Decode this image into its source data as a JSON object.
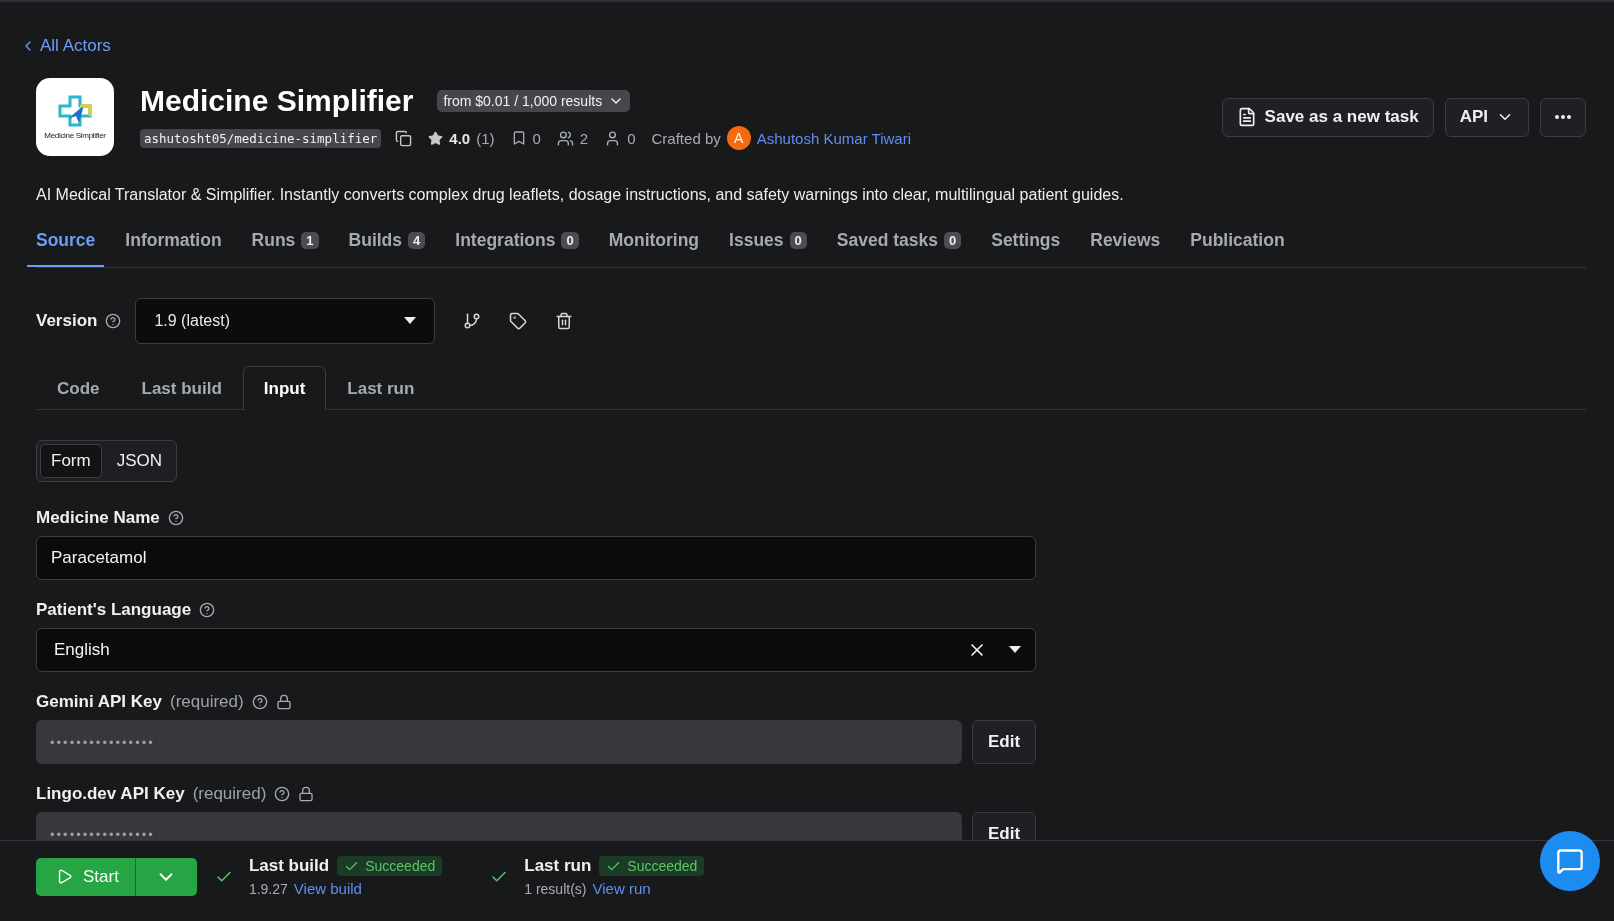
{
  "back_link": "All Actors",
  "actor": {
    "title": "Medicine Simplifier",
    "logo_caption": "Medicine Simplifier",
    "pricing": "from $0.01 / 1,000 results",
    "slug": "ashutosht05/medicine-simplifier",
    "rating": "4.0",
    "rating_count": "(1)",
    "bookmarks": "0",
    "users": "2",
    "monthly_users": "0",
    "crafted_by_label": "Crafted by",
    "author_initial": "A",
    "author": "Ashutosh Kumar Tiwari",
    "description": "AI Medical Translator & Simplifier. Instantly converts complex drug leaflets, dosage instructions, and safety warnings into clear, multilingual patient guides."
  },
  "header_actions": [
    {
      "kind": "task",
      "label": "Save as a new task"
    },
    {
      "kind": "dropdown",
      "label": "API"
    },
    {
      "kind": "more"
    }
  ],
  "tabs": [
    {
      "label": "Source",
      "selected": true
    },
    {
      "label": "Information",
      "selected": false
    },
    {
      "label": "Runs",
      "count": "1",
      "selected": false
    },
    {
      "label": "Builds",
      "count": "4",
      "selected": false
    },
    {
      "label": "Integrations",
      "count": "0",
      "selected": false
    },
    {
      "label": "Monitoring",
      "selected": false
    },
    {
      "label": "Issues",
      "count": "0",
      "selected": false
    },
    {
      "label": "Saved tasks",
      "count": "0",
      "selected": false
    },
    {
      "label": "Settings",
      "selected": false
    },
    {
      "label": "Reviews",
      "selected": false
    },
    {
      "label": "Publication",
      "selected": false
    }
  ],
  "version": {
    "label": "Version",
    "value": "1.9 (latest)"
  },
  "subtabs": [
    {
      "label": "Code",
      "selected": false
    },
    {
      "label": "Last build",
      "selected": false
    },
    {
      "label": "Input",
      "selected": true
    },
    {
      "label": "Last run",
      "selected": false
    }
  ],
  "mode_toggle": [
    {
      "label": "Form",
      "selected": true
    },
    {
      "label": "JSON",
      "selected": false
    }
  ],
  "fields": [
    {
      "kind": "text",
      "label": "Medicine Name",
      "value": "Paracetamol"
    },
    {
      "kind": "select",
      "label": "Patient's Language",
      "value": "English"
    },
    {
      "kind": "secret",
      "label": "Gemini API Key",
      "note": "(required)",
      "value": "••••••••••••••••",
      "button": "Edit"
    },
    {
      "kind": "secret",
      "label": "Lingo.dev API Key",
      "note": "(required)",
      "value": "••••••••••••••••",
      "button": "Edit"
    }
  ],
  "bottom_bar": {
    "start": "Start",
    "statuses": [
      {
        "title": "Last build",
        "status": "Succeeded",
        "detail": "1.9.27",
        "link": "View build"
      },
      {
        "title": "Last run",
        "status": "Succeeded",
        "detail": "1 result(s)",
        "link": "View run"
      }
    ]
  }
}
